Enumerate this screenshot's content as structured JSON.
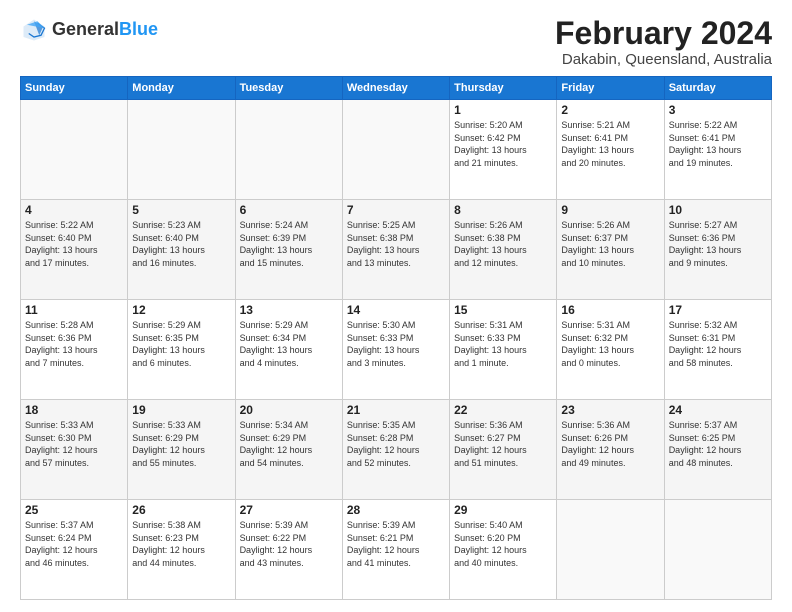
{
  "header": {
    "logo_general": "General",
    "logo_blue": "Blue",
    "month_title": "February 2024",
    "location": "Dakabin, Queensland, Australia"
  },
  "days_of_week": [
    "Sunday",
    "Monday",
    "Tuesday",
    "Wednesday",
    "Thursday",
    "Friday",
    "Saturday"
  ],
  "weeks": [
    [
      {
        "day": "",
        "info": ""
      },
      {
        "day": "",
        "info": ""
      },
      {
        "day": "",
        "info": ""
      },
      {
        "day": "",
        "info": ""
      },
      {
        "day": "1",
        "info": "Sunrise: 5:20 AM\nSunset: 6:42 PM\nDaylight: 13 hours\nand 21 minutes."
      },
      {
        "day": "2",
        "info": "Sunrise: 5:21 AM\nSunset: 6:41 PM\nDaylight: 13 hours\nand 20 minutes."
      },
      {
        "day": "3",
        "info": "Sunrise: 5:22 AM\nSunset: 6:41 PM\nDaylight: 13 hours\nand 19 minutes."
      }
    ],
    [
      {
        "day": "4",
        "info": "Sunrise: 5:22 AM\nSunset: 6:40 PM\nDaylight: 13 hours\nand 17 minutes."
      },
      {
        "day": "5",
        "info": "Sunrise: 5:23 AM\nSunset: 6:40 PM\nDaylight: 13 hours\nand 16 minutes."
      },
      {
        "day": "6",
        "info": "Sunrise: 5:24 AM\nSunset: 6:39 PM\nDaylight: 13 hours\nand 15 minutes."
      },
      {
        "day": "7",
        "info": "Sunrise: 5:25 AM\nSunset: 6:38 PM\nDaylight: 13 hours\nand 13 minutes."
      },
      {
        "day": "8",
        "info": "Sunrise: 5:26 AM\nSunset: 6:38 PM\nDaylight: 13 hours\nand 12 minutes."
      },
      {
        "day": "9",
        "info": "Sunrise: 5:26 AM\nSunset: 6:37 PM\nDaylight: 13 hours\nand 10 minutes."
      },
      {
        "day": "10",
        "info": "Sunrise: 5:27 AM\nSunset: 6:36 PM\nDaylight: 13 hours\nand 9 minutes."
      }
    ],
    [
      {
        "day": "11",
        "info": "Sunrise: 5:28 AM\nSunset: 6:36 PM\nDaylight: 13 hours\nand 7 minutes."
      },
      {
        "day": "12",
        "info": "Sunrise: 5:29 AM\nSunset: 6:35 PM\nDaylight: 13 hours\nand 6 minutes."
      },
      {
        "day": "13",
        "info": "Sunrise: 5:29 AM\nSunset: 6:34 PM\nDaylight: 13 hours\nand 4 minutes."
      },
      {
        "day": "14",
        "info": "Sunrise: 5:30 AM\nSunset: 6:33 PM\nDaylight: 13 hours\nand 3 minutes."
      },
      {
        "day": "15",
        "info": "Sunrise: 5:31 AM\nSunset: 6:33 PM\nDaylight: 13 hours\nand 1 minute."
      },
      {
        "day": "16",
        "info": "Sunrise: 5:31 AM\nSunset: 6:32 PM\nDaylight: 13 hours\nand 0 minutes."
      },
      {
        "day": "17",
        "info": "Sunrise: 5:32 AM\nSunset: 6:31 PM\nDaylight: 12 hours\nand 58 minutes."
      }
    ],
    [
      {
        "day": "18",
        "info": "Sunrise: 5:33 AM\nSunset: 6:30 PM\nDaylight: 12 hours\nand 57 minutes."
      },
      {
        "day": "19",
        "info": "Sunrise: 5:33 AM\nSunset: 6:29 PM\nDaylight: 12 hours\nand 55 minutes."
      },
      {
        "day": "20",
        "info": "Sunrise: 5:34 AM\nSunset: 6:29 PM\nDaylight: 12 hours\nand 54 minutes."
      },
      {
        "day": "21",
        "info": "Sunrise: 5:35 AM\nSunset: 6:28 PM\nDaylight: 12 hours\nand 52 minutes."
      },
      {
        "day": "22",
        "info": "Sunrise: 5:36 AM\nSunset: 6:27 PM\nDaylight: 12 hours\nand 51 minutes."
      },
      {
        "day": "23",
        "info": "Sunrise: 5:36 AM\nSunset: 6:26 PM\nDaylight: 12 hours\nand 49 minutes."
      },
      {
        "day": "24",
        "info": "Sunrise: 5:37 AM\nSunset: 6:25 PM\nDaylight: 12 hours\nand 48 minutes."
      }
    ],
    [
      {
        "day": "25",
        "info": "Sunrise: 5:37 AM\nSunset: 6:24 PM\nDaylight: 12 hours\nand 46 minutes."
      },
      {
        "day": "26",
        "info": "Sunrise: 5:38 AM\nSunset: 6:23 PM\nDaylight: 12 hours\nand 44 minutes."
      },
      {
        "day": "27",
        "info": "Sunrise: 5:39 AM\nSunset: 6:22 PM\nDaylight: 12 hours\nand 43 minutes."
      },
      {
        "day": "28",
        "info": "Sunrise: 5:39 AM\nSunset: 6:21 PM\nDaylight: 12 hours\nand 41 minutes."
      },
      {
        "day": "29",
        "info": "Sunrise: 5:40 AM\nSunset: 6:20 PM\nDaylight: 12 hours\nand 40 minutes."
      },
      {
        "day": "",
        "info": ""
      },
      {
        "day": "",
        "info": ""
      }
    ]
  ]
}
